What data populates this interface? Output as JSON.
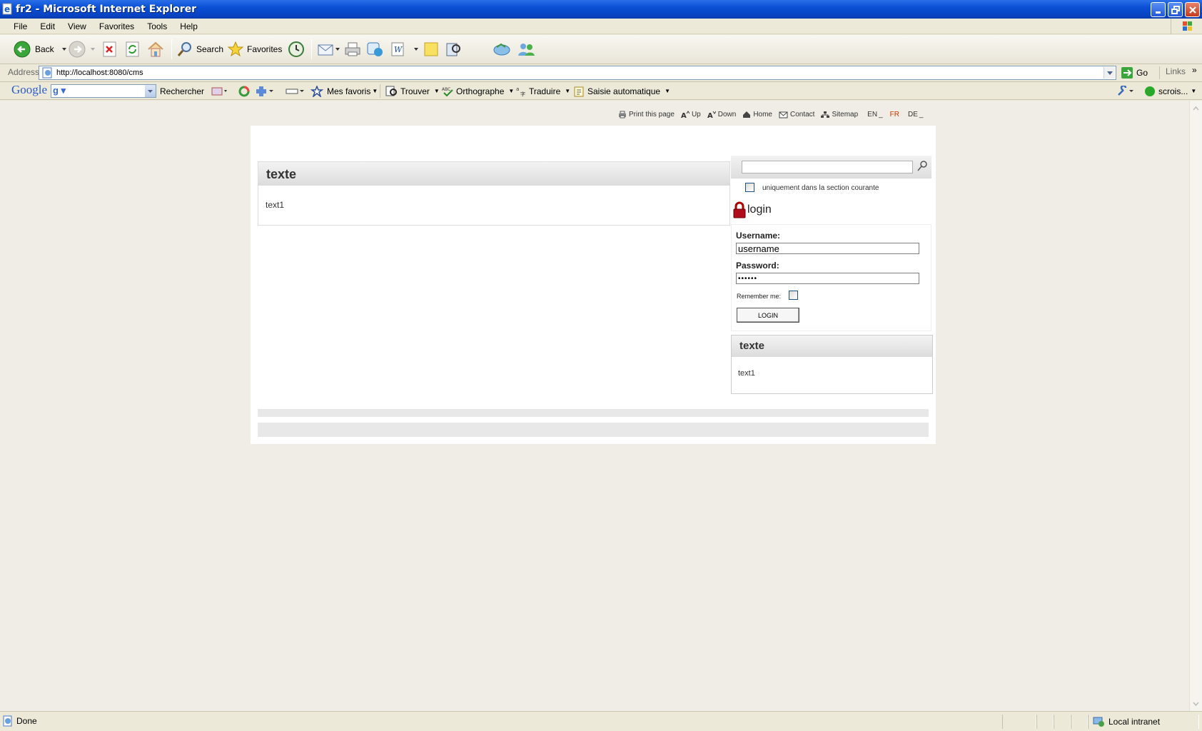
{
  "window": {
    "title": "fr2 - Microsoft Internet Explorer"
  },
  "menu": [
    "File",
    "Edit",
    "View",
    "Favorites",
    "Tools",
    "Help"
  ],
  "toolbar": {
    "back": "Back",
    "search": "Search",
    "favorites": "Favorites"
  },
  "address": {
    "label": "Address",
    "url": "http://localhost:8080/cms",
    "go": "Go",
    "links": "Links"
  },
  "google": {
    "logo": "Google",
    "rechercher": "Rechercher",
    "mes_favoris": "Mes favoris",
    "trouver": "Trouver",
    "orthographe": "Orthographe",
    "traduire": "Traduire",
    "saisie": "Saisie automatique",
    "user": "scrois..."
  },
  "topnav": {
    "print": "Print this page",
    "up": "Up",
    "down": "Down",
    "home": "Home",
    "contact": "Contact",
    "sitemap": "Sitemap",
    "lang_en": "EN",
    "lang_fr": "FR",
    "lang_de": "DE",
    "active_lang_color": "#cc3300"
  },
  "main_panel": {
    "title": "texte",
    "body": "text1"
  },
  "search": {
    "value": "",
    "scope_label": "uniquement dans la section courante",
    "scope_checked": false
  },
  "login": {
    "title": "login",
    "username_label": "Username:",
    "username_value": "username",
    "password_label": "Password:",
    "password_value": "••••••",
    "remember_label": "Remember me:",
    "remember_checked": false,
    "button": "LOGIN"
  },
  "side_panel": {
    "title": "texte",
    "body": "text1"
  },
  "status": {
    "text": "Done",
    "zone": "Local intranet"
  }
}
